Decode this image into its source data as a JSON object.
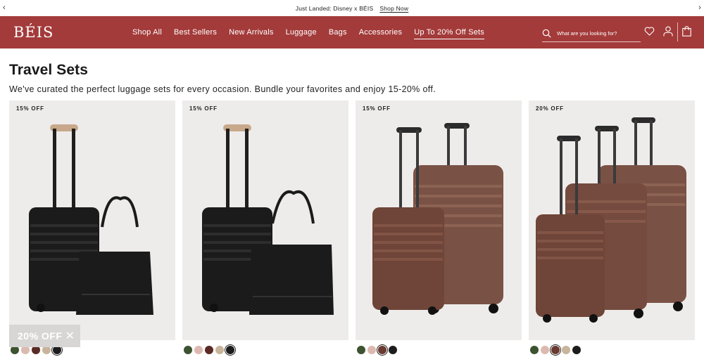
{
  "announcement": {
    "message": "Just Landed: Disney x BÉIS",
    "link": "Shop Now",
    "prev_icon": "chevron-left-icon",
    "next_icon": "chevron-right-icon"
  },
  "header": {
    "logo": "BÉIS",
    "brand_color": "#a33b3a",
    "nav": [
      "Shop All",
      "Best Sellers",
      "New Arrivals",
      "Luggage",
      "Bags",
      "Accessories",
      "Up To 20% Off Sets"
    ],
    "active_nav": "Up To 20% Off Sets",
    "search_placeholder": "What are you looking for?",
    "icons": [
      "search-icon",
      "heart-icon",
      "account-icon",
      "bag-icon"
    ]
  },
  "page": {
    "title": "Travel Sets",
    "subtitle": "We've curated the perfect luggage sets for every occasion. Bundle your favorites and enjoy 15-20% off."
  },
  "products": [
    {
      "badge": "15% OFF",
      "swatches": [
        "#3d5230",
        "#dcb9b0",
        "#5a2b24",
        "#c8b49a",
        "#1c1c1c"
      ],
      "selected": 4
    },
    {
      "badge": "15% OFF",
      "swatches": [
        "#3d5230",
        "#dcb9b0",
        "#5a2b24",
        "#c8b49a",
        "#1c1c1c"
      ],
      "selected": 4
    },
    {
      "badge": "15% OFF",
      "swatches": [
        "#3d5230",
        "#dcb9b0",
        "#6a3a30",
        "#1c1c1c"
      ],
      "selected": 2
    },
    {
      "badge": "20% OFF",
      "swatches": [
        "#3d5230",
        "#dcb9b0",
        "#6a3a30",
        "#c8b49a",
        "#1c1c1c"
      ],
      "selected": 2
    }
  ],
  "promo": {
    "text": "20% OFF",
    "close_icon": "close-icon"
  }
}
